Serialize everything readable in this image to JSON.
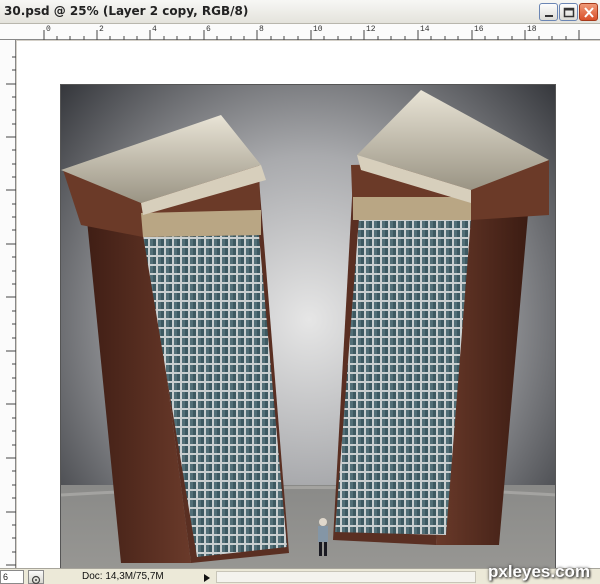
{
  "window": {
    "title": "30.psd @ 25% (Layer 2 copy, RGB/8)"
  },
  "ruler": {
    "top_labels": [
      "0",
      "2",
      "4",
      "6",
      "8",
      "10",
      "12",
      "14",
      "16",
      "18"
    ]
  },
  "statusbar": {
    "zoom_value": "6",
    "doc_info": "Doc: 14,3M/75,7M"
  },
  "watermark": {
    "text": "pxleyes.com"
  },
  "colors": {
    "sky_dark": "#2e3034",
    "sky_light": "#d9d9d9",
    "brick": "#5a2f22",
    "glass": "#4d6b72",
    "roof": "#cfc8b8"
  },
  "icons": {
    "minimize": "minimize-icon",
    "maximize": "maximize-icon",
    "close": "close-icon",
    "navigator": "navigator-icon",
    "arrow": "arrow-right-icon"
  }
}
